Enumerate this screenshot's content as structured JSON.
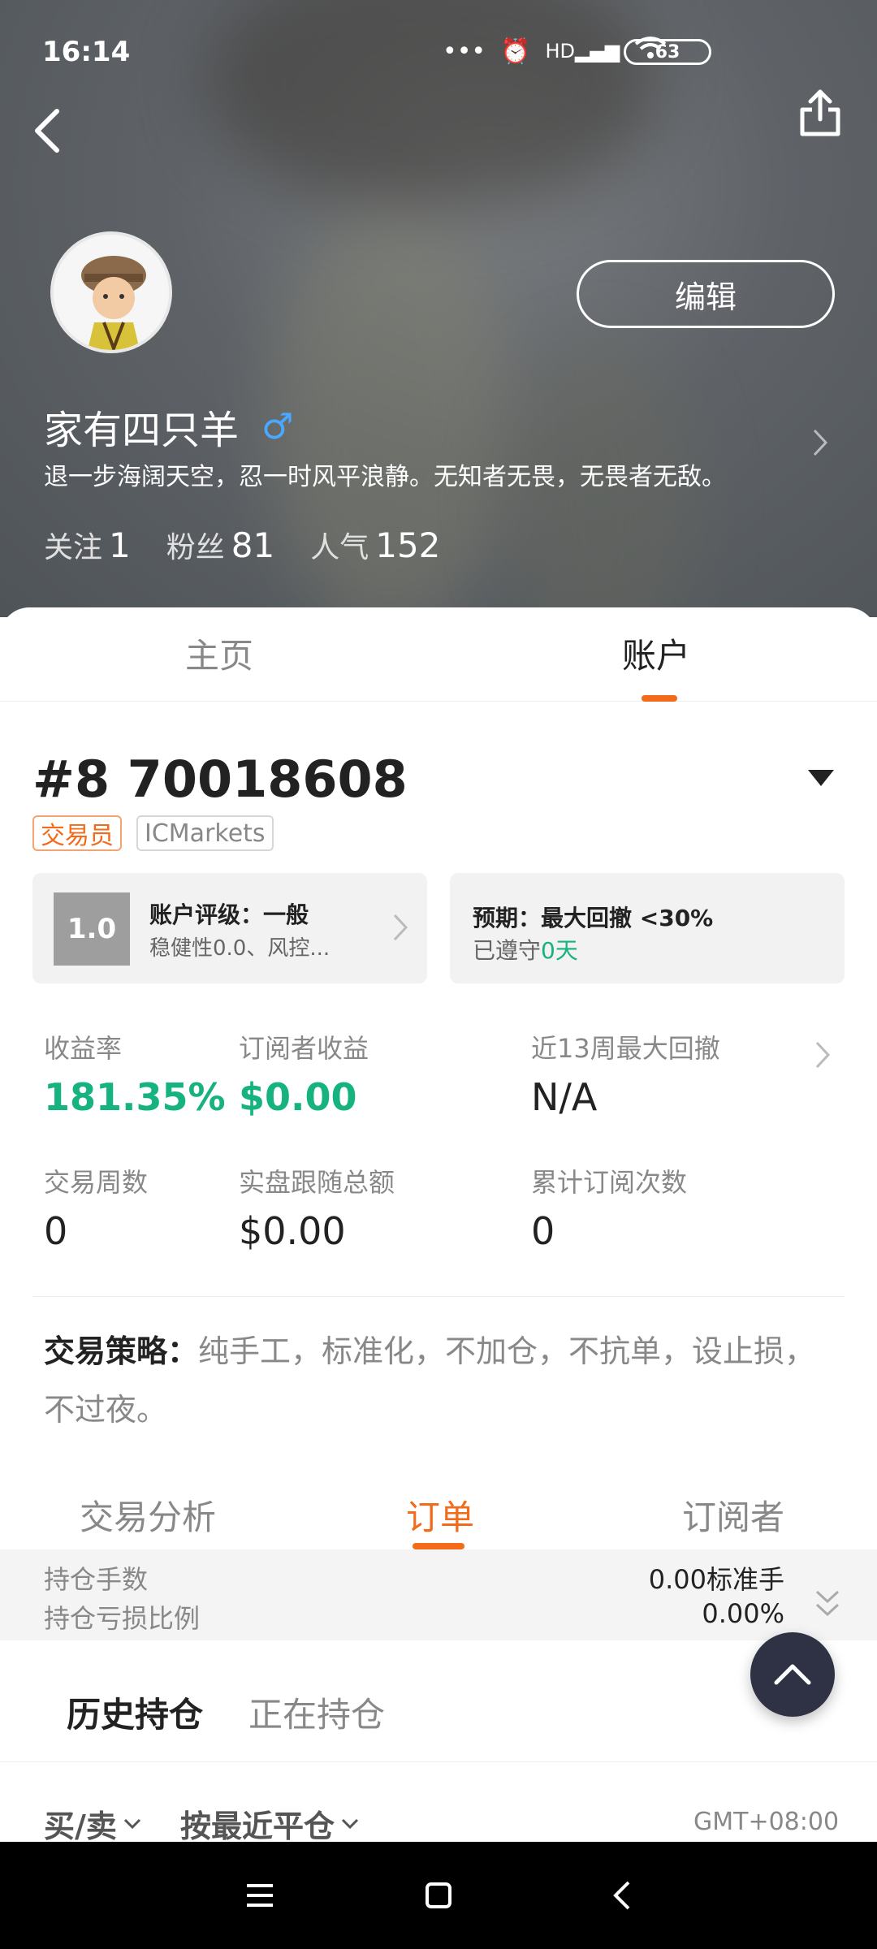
{
  "status_bar": {
    "time": "16:14",
    "battery": "63",
    "network": "HD"
  },
  "header": {
    "edit_label": "编辑",
    "user_name": "家有四只羊",
    "gender_symbol": "♂",
    "bio": "退一步海阔天空，忍一时风平浪静。无知者无畏，无畏者无敌。",
    "stats": [
      {
        "label": "关注",
        "value": "1"
      },
      {
        "label": "粉丝",
        "value": "81"
      },
      {
        "label": "人气",
        "value": "152"
      }
    ]
  },
  "main_tabs": [
    {
      "label": "主页",
      "selected": false
    },
    {
      "label": "账户",
      "selected": true
    }
  ],
  "account": {
    "number": "#8 70018608",
    "tags": [
      "交易员",
      "ICMarkets"
    ],
    "rating_score": "1.0",
    "rating_title": "账户评级：一般",
    "rating_sub": "稳健性0.0、风控...",
    "expect_title": "预期：最大回撤 <30%",
    "expect_sub_prefix": "已遵守",
    "expect_sub_days": "0天"
  },
  "metrics": [
    {
      "label": "收益率",
      "value": "181.35%"
    },
    {
      "label": "订阅者收益",
      "value": "$0.00"
    },
    {
      "label": "近13周最大回撤",
      "value": "N/A"
    },
    {
      "label": "交易周数",
      "value": "0"
    },
    {
      "label": "实盘跟随总额",
      "value": "$0.00"
    },
    {
      "label": "累计订阅次数",
      "value": "0"
    }
  ],
  "strategy": {
    "label": "交易策略：",
    "text": "纯手工，标准化，不加仓，不抗单，设止损，不过夜。"
  },
  "sub_tabs": [
    {
      "label": "交易分析"
    },
    {
      "label": "订单",
      "selected": true
    },
    {
      "label": "订阅者"
    }
  ],
  "position": {
    "lots_label": "持仓手数",
    "lots_value": "0.00标准手",
    "ratio_label": "持仓亏损比例",
    "ratio_value": "0.00%"
  },
  "history_tabs": [
    {
      "label": "历史持仓",
      "selected": true
    },
    {
      "label": "正在持仓"
    }
  ],
  "filters": {
    "side": "买/卖",
    "sort": "按最近平仓",
    "timezone": "GMT+08:00"
  },
  "colors": {
    "accent": "#f26a1a",
    "positive": "#16b280",
    "fab": "#2f3244"
  }
}
